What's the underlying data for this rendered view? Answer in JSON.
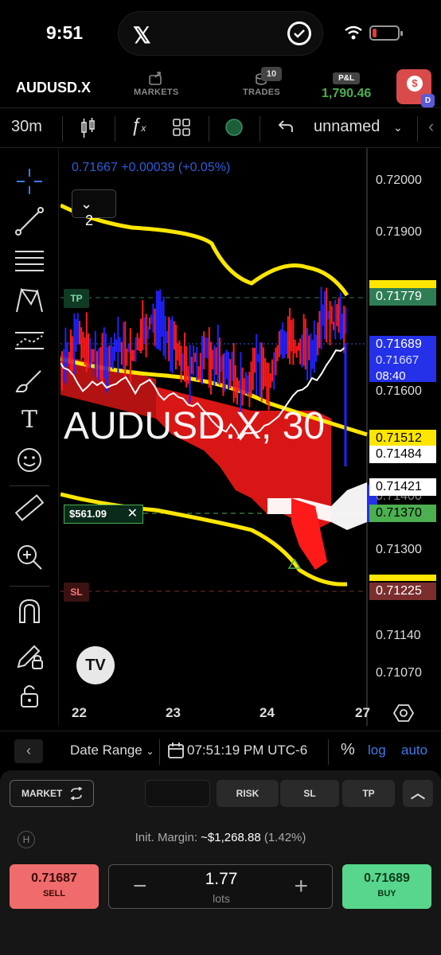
{
  "status_bar": {
    "time": "9:51",
    "battery_level": 0.15
  },
  "nav": {
    "symbol": "AUDUSD.X",
    "markets_label": "MARKETS",
    "trades_label": "TRADES",
    "trades_count": "10",
    "pnl_label": "P&L",
    "pnl_value": "1,790.46",
    "account_badge": "D"
  },
  "toolbar": {
    "timeframe": "30m",
    "layout_name": "unnamed"
  },
  "chart": {
    "price_line": "0.71667 +0.00039 (+0.05%)",
    "legend_count": "2",
    "watermark": "AUDUSD.X, 30",
    "price_axis": [
      "0.72000",
      "0.71900",
      "0.71600",
      "0.71400",
      "0.71300",
      "0.71140",
      "0.71070"
    ],
    "tags": {
      "tp": "0.71779",
      "current": "0.71689",
      "current_sub": "0.71667",
      "countdown": "08:40",
      "yellow_upper": "0.71512",
      "white_a": "0.71484",
      "white_b": "0.71421",
      "entry": "0.71370",
      "sl": "0.71225"
    },
    "tp_label": "TP",
    "sl_label": "SL",
    "position_pl": "$561.09",
    "date_labels": [
      "22",
      "23",
      "24",
      "27"
    ],
    "colors": {
      "up": "#2222ff",
      "down": "#ff1a1a",
      "ma": "#ffe600",
      "tp": "#2e7d55",
      "sl": "#7a2e2e"
    }
  },
  "range_bar": {
    "date_range": "Date Range",
    "time": "07:51:19 PM UTC-6",
    "percent": "%",
    "log": "log",
    "auto": "auto"
  },
  "trade_panel": {
    "order_type": "MARKET",
    "risk": "RISK",
    "sl": "SL",
    "tp": "TP",
    "margin_label": "Init. Margin:",
    "margin_value": "~$1,268.88",
    "margin_pct": "(1.42%)",
    "sell_price": "0.71687",
    "sell_label": "SELL",
    "buy_price": "0.71689",
    "buy_label": "BUY",
    "lots_value": "1.77",
    "lots_label": "lots"
  }
}
